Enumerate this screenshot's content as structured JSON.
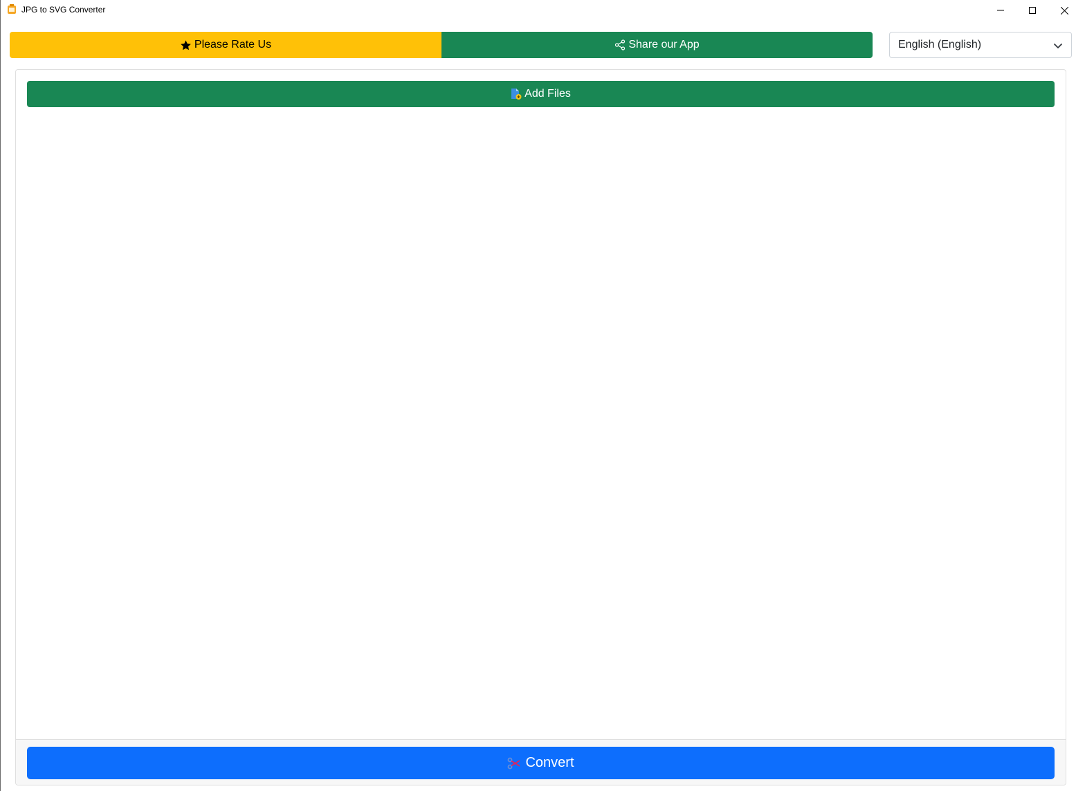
{
  "window": {
    "title": "JPG to SVG Converter",
    "controls": {
      "minimize_icon": "minimize-icon",
      "maximize_icon": "maximize-icon",
      "close_icon": "close-icon"
    }
  },
  "toolbar": {
    "rate_label": "Please Rate Us",
    "rate_icon": "star-icon",
    "rate_color": "#ffc107",
    "share_label": "Share our App",
    "share_icon": "share-icon",
    "share_color": "#198754"
  },
  "language": {
    "selected": "English (English)"
  },
  "main": {
    "add_files_label": "Add Files",
    "add_files_icon": "add-file-icon",
    "convert_label": "Convert",
    "convert_icon": "convert-icon",
    "convert_color": "#0d6efd"
  }
}
